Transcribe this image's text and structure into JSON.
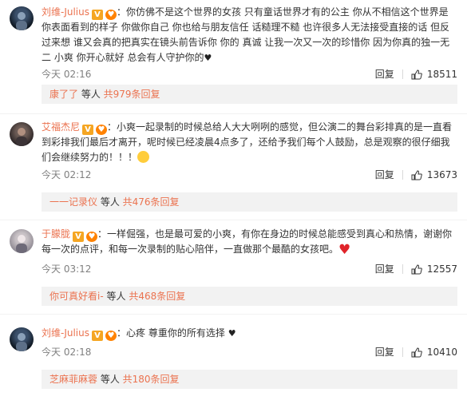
{
  "comments": [
    {
      "nickname": "刘维-Julius",
      "text": "你仿佛不是这个世界的女孩 只有童话世界才有的公主 你从不相信这个世界是你表面看到的样子 你做你自己 你也给与朋友信任 话糙理不糙 也许很多人无法接受直接的话 但反过来想 谁又会真的把真实在镜头前告诉你 你的 真诚 让我一次又一次的珍惜你 因为你真的独一无二 小爽 你开心就好 总会有人守护你的",
      "time": "今天 02:16",
      "reply": "回复",
      "likes": "18511",
      "sub_name": "康了了",
      "sub_mid": " 等人 ",
      "sub_count": "共979条回复"
    },
    {
      "nickname": "艾福杰尼",
      "text": "小爽一起录制的时候总给人大大咧咧的感觉，但公演二的舞台彩排真的是一直看到彩排我们最后才离开，呢时候已经凌晨4点多了，还给予我们每个人鼓励，总是观察的很仔细我们会继续努力的！！！",
      "time": "今天 02:12",
      "reply": "回复",
      "likes": "13673",
      "sub_name": "一一记录仪",
      "sub_mid": " 等人 ",
      "sub_count": "共476条回复"
    },
    {
      "nickname": "于朦胧",
      "text": "一样倔强，也是最可爱的小爽，有你在身边的时候总能感受到真心和热情，谢谢你每一次的点评，和每一次录制的贴心陪伴，一直做那个最酷的女孩吧。",
      "time": "今天 03:12",
      "reply": "回复",
      "likes": "12557",
      "sub_name": "你可真好看i-",
      "sub_mid": " 等人 ",
      "sub_count": "共468条回复"
    },
    {
      "nickname": "刘维-Julius",
      "text": "心疼 尊重你的所有选择",
      "time": "今天 02:18",
      "reply": "回复",
      "likes": "10410",
      "sub_name": "芝麻菲麻蓉",
      "sub_mid": " 等人 ",
      "sub_count": "共180条回复"
    }
  ],
  "colors": {
    "accent": "#eb7350",
    "text": "#333333",
    "meta": "#808080",
    "sub_bg": "#f2f2f2"
  },
  "icons": [
    "v-badge",
    "fan-badge",
    "like-icon",
    "heart-emoji",
    "crying-emoji"
  ]
}
